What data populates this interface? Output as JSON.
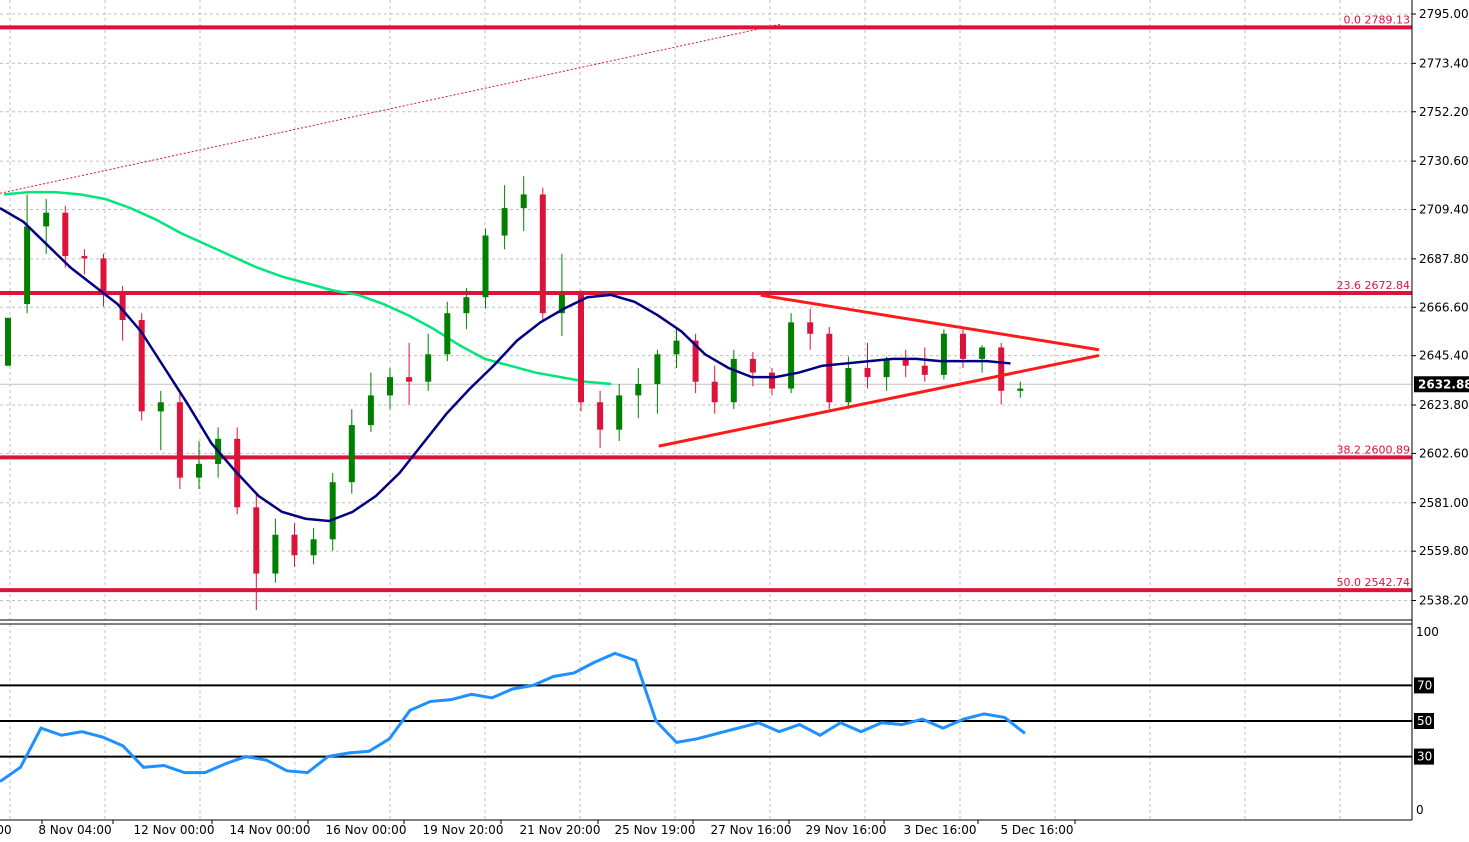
{
  "colors": {
    "bull": "#008000",
    "bear": "#dc143c",
    "grid": "#c0c0c0",
    "fib": "#dc143c",
    "ma_fast": "#000080",
    "ma_slow": "#00e67a",
    "oscillator": "#1e90ff",
    "triangle": "#ff1a1a",
    "price_tag_bg": "#000000"
  },
  "current_price": "2632.88",
  "chart_data": [
    {
      "type": "candlestick",
      "ylim": [
        2528,
        2800
      ],
      "y_ticks": [
        "2795.00",
        "2773.40",
        "2752.20",
        "2730.60",
        "2709.40",
        "2687.80",
        "2666.60",
        "2645.40",
        "2623.80",
        "2602.60",
        "2581.00",
        "2559.80",
        "2538.20"
      ],
      "fib_levels": [
        {
          "label": "0.0 2789.13",
          "price": 2789.13
        },
        {
          "label": "23.6 2672.84",
          "price": 2672.84
        },
        {
          "label": "38.2 2600.89",
          "price": 2600.89
        },
        {
          "label": "50.0 2542.74",
          "price": 2542.74
        }
      ],
      "triangle": {
        "upper": [
          [
            41.5,
            2671.9
          ],
          [
            54.5,
            2648.0
          ]
        ],
        "lower": [
          [
            32.5,
            2605.8
          ],
          [
            54.5,
            2645.5
          ]
        ]
      },
      "diag_dotted": [
        [
          0,
          2716.5
        ],
        [
          40.5,
          2790.6
        ]
      ],
      "candles": [
        {
          "o": 2641,
          "h": 2659,
          "l": 2641,
          "c": 2662
        },
        {
          "o": 2668,
          "h": 2716,
          "l": 2664,
          "c": 2702
        },
        {
          "o": 2702,
          "h": 2714,
          "l": 2690,
          "c": 2708
        },
        {
          "o": 2708,
          "h": 2711,
          "l": 2684,
          "c": 2689
        },
        {
          "o": 2689,
          "h": 2692,
          "l": 2681,
          "c": 2688
        },
        {
          "o": 2688,
          "h": 2690,
          "l": 2667,
          "c": 2673
        },
        {
          "o": 2673,
          "h": 2676,
          "l": 2652,
          "c": 2661
        },
        {
          "o": 2661,
          "h": 2664,
          "l": 2617,
          "c": 2621
        },
        {
          "o": 2621,
          "h": 2630,
          "l": 2604,
          "c": 2625
        },
        {
          "o": 2625,
          "h": 2629,
          "l": 2587,
          "c": 2592
        },
        {
          "o": 2592,
          "h": 2608,
          "l": 2587,
          "c": 2598
        },
        {
          "o": 2598,
          "h": 2614,
          "l": 2592,
          "c": 2609
        },
        {
          "o": 2609,
          "h": 2614,
          "l": 2576,
          "c": 2579
        },
        {
          "o": 2579,
          "h": 2585,
          "l": 2534,
          "c": 2550
        },
        {
          "o": 2550,
          "h": 2574,
          "l": 2546,
          "c": 2567
        },
        {
          "o": 2567,
          "h": 2572,
          "l": 2553,
          "c": 2558
        },
        {
          "o": 2558,
          "h": 2570,
          "l": 2554,
          "c": 2565
        },
        {
          "o": 2565,
          "h": 2594,
          "l": 2560,
          "c": 2590
        },
        {
          "o": 2590,
          "h": 2622,
          "l": 2585,
          "c": 2615
        },
        {
          "o": 2615,
          "h": 2638,
          "l": 2612,
          "c": 2628
        },
        {
          "o": 2628,
          "h": 2640,
          "l": 2622,
          "c": 2636
        },
        {
          "o": 2636,
          "h": 2651,
          "l": 2624,
          "c": 2634
        },
        {
          "o": 2634,
          "h": 2655,
          "l": 2630,
          "c": 2646
        },
        {
          "o": 2646,
          "h": 2669,
          "l": 2643,
          "c": 2664
        },
        {
          "o": 2664,
          "h": 2675,
          "l": 2657,
          "c": 2671
        },
        {
          "o": 2671,
          "h": 2701,
          "l": 2666,
          "c": 2698
        },
        {
          "o": 2698,
          "h": 2720,
          "l": 2692,
          "c": 2710
        },
        {
          "o": 2710,
          "h": 2724,
          "l": 2700,
          "c": 2716
        },
        {
          "o": 2716,
          "h": 2719,
          "l": 2660,
          "c": 2664
        },
        {
          "o": 2664,
          "h": 2690,
          "l": 2654,
          "c": 2672
        },
        {
          "o": 2672,
          "h": 2674,
          "l": 2621,
          "c": 2625
        },
        {
          "o": 2625,
          "h": 2630,
          "l": 2605,
          "c": 2613
        },
        {
          "o": 2613,
          "h": 2633,
          "l": 2608,
          "c": 2628
        },
        {
          "o": 2628,
          "h": 2640,
          "l": 2618,
          "c": 2633
        },
        {
          "o": 2633,
          "h": 2648,
          "l": 2620,
          "c": 2646
        },
        {
          "o": 2646,
          "h": 2658,
          "l": 2640,
          "c": 2652
        },
        {
          "o": 2652,
          "h": 2655,
          "l": 2629,
          "c": 2634
        },
        {
          "o": 2634,
          "h": 2641,
          "l": 2620,
          "c": 2625
        },
        {
          "o": 2625,
          "h": 2648,
          "l": 2622,
          "c": 2644
        },
        {
          "o": 2644,
          "h": 2647,
          "l": 2632,
          "c": 2638
        },
        {
          "o": 2638,
          "h": 2640,
          "l": 2628,
          "c": 2631
        },
        {
          "o": 2631,
          "h": 2664,
          "l": 2629,
          "c": 2660
        },
        {
          "o": 2660,
          "h": 2666,
          "l": 2648,
          "c": 2655
        },
        {
          "o": 2655,
          "h": 2658,
          "l": 2622,
          "c": 2625
        },
        {
          "o": 2625,
          "h": 2645,
          "l": 2622,
          "c": 2640
        },
        {
          "o": 2640,
          "h": 2651,
          "l": 2631,
          "c": 2636
        },
        {
          "o": 2636,
          "h": 2645,
          "l": 2630,
          "c": 2644
        },
        {
          "o": 2644,
          "h": 2648,
          "l": 2636,
          "c": 2641
        },
        {
          "o": 2641,
          "h": 2649,
          "l": 2634,
          "c": 2637
        },
        {
          "o": 2637,
          "h": 2657,
          "l": 2635,
          "c": 2655
        },
        {
          "o": 2655,
          "h": 2657,
          "l": 2640,
          "c": 2644
        },
        {
          "o": 2644,
          "h": 2650,
          "l": 2638,
          "c": 2649
        },
        {
          "o": 2649,
          "h": 2651,
          "l": 2624,
          "c": 2630
        },
        {
          "o": 2630,
          "h": 2634,
          "l": 2627,
          "c": 2631
        }
      ],
      "ma_fast": [
        2710,
        2704,
        2694,
        2684,
        2676,
        2668,
        2656,
        2640,
        2624,
        2607,
        2595,
        2584,
        2577,
        2574,
        2573,
        2577,
        2584,
        2594,
        2607,
        2620,
        2631,
        2641,
        2652,
        2660,
        2666,
        2671,
        2672,
        2669,
        2663,
        2656,
        2646,
        2640,
        2636,
        2636,
        2638,
        2641,
        2642,
        2643,
        2644,
        2644,
        2643,
        2643,
        2643,
        2642
      ],
      "ma_slow": [
        2716,
        2717,
        2717,
        2716,
        2714,
        2710,
        2705,
        2699,
        2694,
        2689,
        2684,
        2680,
        2677,
        2674,
        2672,
        2668,
        2663,
        2657,
        2650,
        2644,
        2641,
        2638,
        2636,
        2634,
        2633
      ],
      "oscillator": {
        "ylim": [
          0,
          100
        ],
        "y_ticks": [
          "100",
          "0"
        ],
        "levels": [
          70,
          50,
          30
        ],
        "values": [
          16,
          24,
          46,
          42,
          44,
          41,
          36,
          24,
          25,
          21,
          21,
          26,
          30,
          28,
          22,
          21,
          30,
          32,
          33,
          40,
          56,
          61,
          62,
          65,
          63,
          68,
          70,
          75,
          77,
          83,
          88,
          84,
          50,
          38,
          40,
          43,
          46,
          49,
          44,
          48,
          42,
          49,
          44,
          49,
          48,
          51,
          46,
          51,
          54,
          52,
          43
        ]
      },
      "x_ticks": [
        "00",
        "8 Nov 04:00",
        "12 Nov 00:00",
        "14 Nov 00:00",
        "16 Nov 00:00",
        "19 Nov 20:00",
        "21 Nov 20:00",
        "25 Nov 19:00",
        "27 Nov 16:00",
        "29 Nov 16:00",
        "3 Dec 16:00",
        "5 Dec 16:00"
      ],
      "osc_level_labels": [
        "70",
        "50",
        "30"
      ]
    }
  ]
}
